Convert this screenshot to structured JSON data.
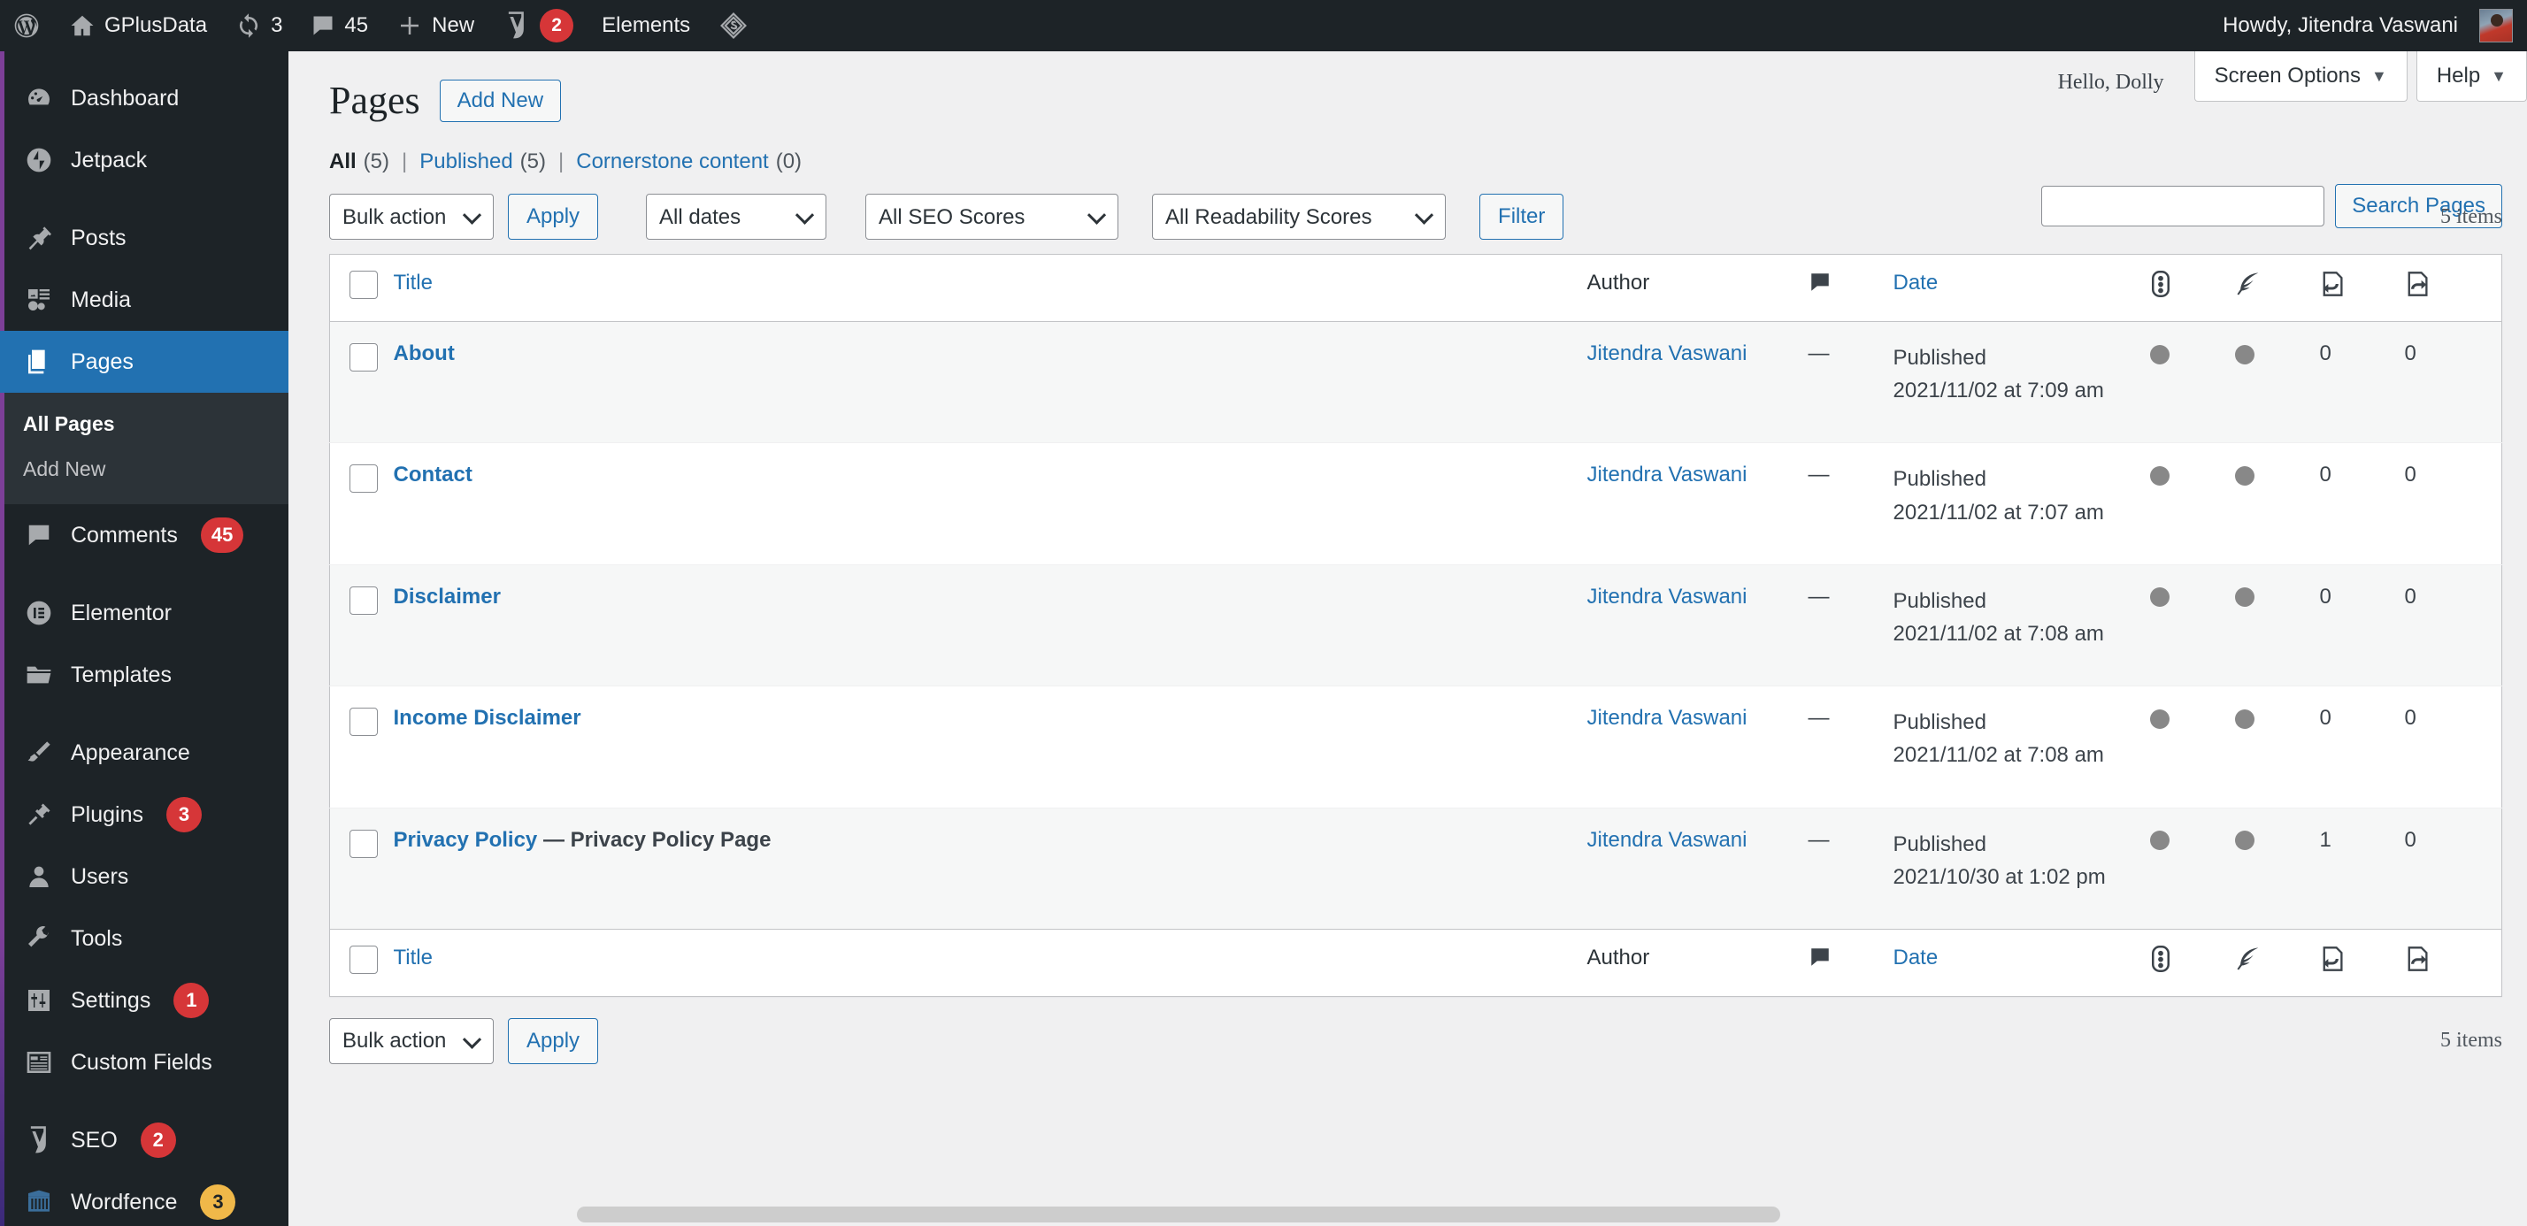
{
  "adminbar": {
    "site_name": "GPlusData",
    "updates_count": "3",
    "comments_count": "45",
    "new_label": "New",
    "yoast_badge": "2",
    "elements_label": "Elements",
    "howdy": "Howdy, Jitendra Vaswani"
  },
  "sidebar": {
    "items": [
      {
        "label": "Dashboard",
        "icon": "dashboard-icon",
        "badge": null,
        "current": false
      },
      {
        "label": "Jetpack",
        "icon": "jetpack-icon",
        "badge": null,
        "current": false
      },
      {
        "label": "Posts",
        "icon": "pin-icon",
        "badge": null,
        "current": false
      },
      {
        "label": "Media",
        "icon": "media-icon",
        "badge": null,
        "current": false
      },
      {
        "label": "Pages",
        "icon": "pages-icon",
        "badge": null,
        "current": true
      },
      {
        "label": "Comments",
        "icon": "comment-icon",
        "badge": "45",
        "current": false
      },
      {
        "label": "Elementor",
        "icon": "elementor-icon",
        "badge": null,
        "current": false
      },
      {
        "label": "Templates",
        "icon": "folder-icon",
        "badge": null,
        "current": false
      },
      {
        "label": "Appearance",
        "icon": "brush-icon",
        "badge": null,
        "current": false
      },
      {
        "label": "Plugins",
        "icon": "plugin-icon",
        "badge": "3",
        "current": false
      },
      {
        "label": "Users",
        "icon": "user-icon",
        "badge": null,
        "current": false
      },
      {
        "label": "Tools",
        "icon": "wrench-icon",
        "badge": null,
        "current": false
      },
      {
        "label": "Settings",
        "icon": "sliders-icon",
        "badge": "1",
        "current": false
      },
      {
        "label": "Custom Fields",
        "icon": "table-icon",
        "badge": null,
        "current": false
      },
      {
        "label": "SEO",
        "icon": "yoast-icon",
        "badge": "2",
        "current": false
      },
      {
        "label": "Wordfence",
        "icon": "wordfence-icon",
        "badge": "3",
        "badge_style": "warn",
        "current": false
      }
    ],
    "submenu": [
      {
        "label": "All Pages",
        "current": true
      },
      {
        "label": "Add New",
        "current": false
      }
    ]
  },
  "screen_meta": {
    "hello_dolly": "Hello, Dolly",
    "screen_options": "Screen Options",
    "help": "Help"
  },
  "header": {
    "title": "Pages",
    "add_new": "Add New"
  },
  "views": {
    "all_label": "All",
    "all_count": "(5)",
    "published_label": "Published",
    "published_count": "(5)",
    "cornerstone_label": "Cornerstone content",
    "cornerstone_count": "(0)",
    "divider": "|"
  },
  "search": {
    "value": "",
    "placeholder": "",
    "button": "Search Pages"
  },
  "tablenav_top": {
    "bulk_actions": "Bulk actions",
    "apply": "Apply",
    "all_dates": "All dates",
    "all_seo_scores": "All SEO Scores",
    "all_readability_scores": "All Readability Scores",
    "filter": "Filter",
    "items": "5 items"
  },
  "tablenav_bottom": {
    "bulk_actions": "Bulk actions",
    "apply": "Apply",
    "items": "5 items"
  },
  "table": {
    "columns": {
      "title": "Title",
      "author": "Author",
      "comments_icon": "comment-icon",
      "date": "Date",
      "seo_icon": "seo-score-icon",
      "readability_icon": "readability-icon",
      "incoming_links_icon": "incoming-links-icon",
      "outgoing_links_icon": "outgoing-links-icon"
    },
    "rows": [
      {
        "title": "About",
        "post_state": "",
        "author": "Jitendra Vaswani",
        "comments": "—",
        "date_status": "Published",
        "date_value": "2021/11/02 at 7:09 am",
        "seo_score": "gray",
        "readability_score": "gray",
        "incoming_links": "0",
        "outgoing_links": "0"
      },
      {
        "title": "Contact",
        "post_state": "",
        "author": "Jitendra Vaswani",
        "comments": "—",
        "date_status": "Published",
        "date_value": "2021/11/02 at 7:07 am",
        "seo_score": "gray",
        "readability_score": "gray",
        "incoming_links": "0",
        "outgoing_links": "0"
      },
      {
        "title": "Disclaimer",
        "post_state": "",
        "author": "Jitendra Vaswani",
        "comments": "—",
        "date_status": "Published",
        "date_value": "2021/11/02 at 7:08 am",
        "seo_score": "gray",
        "readability_score": "gray",
        "incoming_links": "0",
        "outgoing_links": "0"
      },
      {
        "title": "Income Disclaimer",
        "post_state": "",
        "author": "Jitendra Vaswani",
        "comments": "—",
        "date_status": "Published",
        "date_value": "2021/11/02 at 7:08 am",
        "seo_score": "gray",
        "readability_score": "gray",
        "incoming_links": "0",
        "outgoing_links": "0"
      },
      {
        "title": "Privacy Policy",
        "post_state": "— Privacy Policy Page",
        "author": "Jitendra Vaswani",
        "comments": "—",
        "date_status": "Published",
        "date_value": "2021/10/30 at 1:02 pm",
        "seo_score": "gray",
        "readability_score": "gray",
        "incoming_links": "1",
        "outgoing_links": "0"
      }
    ]
  },
  "colors": {
    "adminbar_bg": "#1d2327",
    "sidebar_bg": "#1d2327",
    "current_menu": "#2271b1",
    "link": "#2271b1",
    "badge_red": "#d63638",
    "badge_orange": "#f0b849",
    "content_bg": "#f0f0f1",
    "row_alt": "#f6f7f7"
  }
}
